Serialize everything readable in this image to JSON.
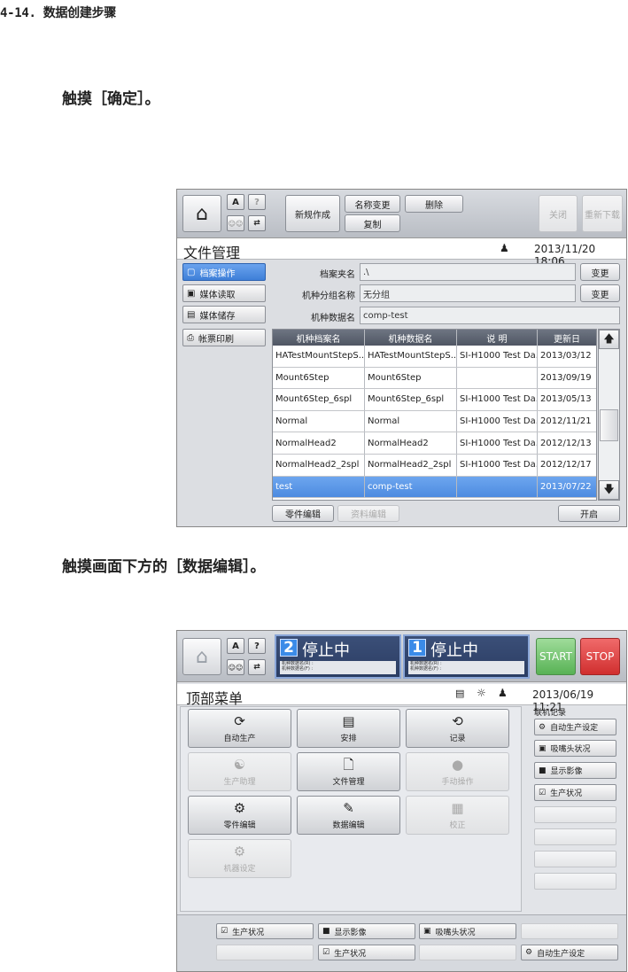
{
  "doc": {
    "heading": "4-14. 数据创建步骤",
    "step1": "触摸［确定］。",
    "step2": "触摸画面下方的［数据编辑］。"
  },
  "screen1": {
    "toolbar": {
      "new_label": "新规作成",
      "rename_label": "名称变更",
      "delete_label": "删除",
      "copy_label": "复制",
      "close_label": "关闭",
      "redownload_label": "重新下载",
      "a_label": "A",
      "q_label": "?"
    },
    "title": "文件管理",
    "datetime": "2013/11/20 18:06",
    "menu": [
      {
        "label": "档案操作"
      },
      {
        "label": "媒体读取"
      },
      {
        "label": "媒体储存"
      },
      {
        "label": "帐票印刷"
      }
    ],
    "fields": {
      "folder_label": "档案夹名",
      "folder_value": ".\\",
      "group_label": "机种分组名称",
      "group_value": "无分组",
      "data_label": "机种数据名",
      "data_value": "comp-test",
      "change_label": "变更"
    },
    "table": {
      "headers": [
        "机种档案名",
        "机种数据名",
        "说 明",
        "更新日"
      ],
      "rows": [
        [
          "HATestMountStepS...",
          "HATestMountStepS...",
          "SI-H1000 Test Da...",
          "2013/03/12"
        ],
        [
          "Mount6Step",
          "Mount6Step",
          "",
          "2013/09/19"
        ],
        [
          "Mount6Step_6spl",
          "Mount6Step_6spl",
          "SI-H1000 Test Da...",
          "2013/05/13"
        ],
        [
          "Normal",
          "Normal",
          "SI-H1000 Test Da...",
          "2012/11/21"
        ],
        [
          "NormalHead2",
          "NormalHead2",
          "SI-H1000 Test Da...",
          "2012/12/13"
        ],
        [
          "NormalHead2_2spl",
          "NormalHead2_2spl",
          "SI-H1000 Test Da...",
          "2012/12/17"
        ],
        [
          "test",
          "comp-test",
          "",
          "2013/07/22"
        ]
      ]
    },
    "bottom": {
      "parts_edit": "零件编辑",
      "resource_edit": "资料编辑",
      "open": "开启"
    }
  },
  "screen2": {
    "toolbar": {
      "a_label": "A",
      "q_label": "?",
      "start_label": "START",
      "stop_label": "STOP"
    },
    "heads": [
      {
        "num": "2",
        "status": "停止中",
        "line1": "机种数据名(R) :",
        "line2": "机种数据名(F) :"
      },
      {
        "num": "1",
        "status": "停止中",
        "line1": "机种数据名(R) :",
        "line2": "机种数据名(F) :"
      }
    ],
    "title": "顶部菜单",
    "datetime": "2013/06/19 11:21",
    "buttons": {
      "auto": "自动生产",
      "schedule": "安排",
      "record": "记录",
      "assist": "生产助理",
      "filemgmt": "文件管理",
      "manual": "手动操作",
      "parts": "零件编辑",
      "dataedit": "数据编辑",
      "calib": "校正",
      "machine": "机器设定"
    },
    "side": {
      "header": "联机记录",
      "items": [
        "自动生产设定",
        "吸嘴头状况",
        "显示影像",
        "生产状况"
      ]
    },
    "bottom": {
      "row1": [
        "生产状况",
        "显示影像",
        "吸嘴头状况"
      ],
      "row2_mid": "生产状况",
      "row2_right": "自动生产设定"
    }
  }
}
